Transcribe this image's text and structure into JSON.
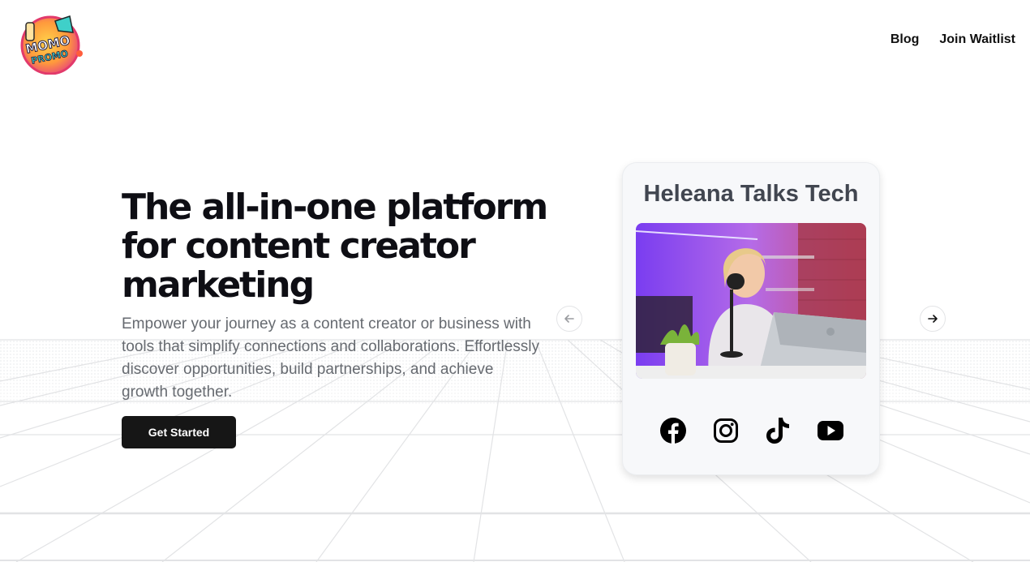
{
  "brand": {
    "logo_top": "MOMO",
    "logo_bottom": "PROMO"
  },
  "nav": {
    "items": [
      {
        "label": "Blog"
      },
      {
        "label": "Join Waitlist"
      }
    ]
  },
  "hero": {
    "title": "The all-in-one platform for content creator marketing",
    "subtitle": "Empower your journey as a content creator or business with tools that simplify connections and collaborations. Effortlessly discover opportunities, build partnerships, and achieve growth together.",
    "cta_label": "Get Started"
  },
  "carousel": {
    "creator_name": "Heleana Talks Tech",
    "socials": [
      "facebook-icon",
      "instagram-icon",
      "tiktok-icon",
      "youtube-icon"
    ]
  },
  "colors": {
    "cta": "#161616",
    "card_bg": "#f7f8fa",
    "title": "#0e0e14",
    "subtitle": "#666a70"
  }
}
